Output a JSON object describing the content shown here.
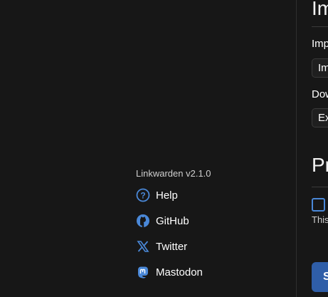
{
  "sidebar": {
    "version": "Linkwarden v2.1.0",
    "links": [
      {
        "label": "Help",
        "icon": "help-circle-icon"
      },
      {
        "label": "GitHub",
        "icon": "github-icon"
      },
      {
        "label": "Twitter",
        "icon": "x-twitter-icon"
      },
      {
        "label": "Mastodon",
        "icon": "mastodon-icon"
      }
    ]
  },
  "main": {
    "import_export_heading": "Import & Export",
    "import_label": "Import your data from other platforms.",
    "import_button": "Import From",
    "download_label": "Download your data",
    "export_button": "Export Data",
    "privacy_heading": "Privacy",
    "privacy_checkbox_desc": "This",
    "save_button": "Save"
  },
  "colors": {
    "accent": "#4a88d8",
    "save": "#2f5ea8",
    "background": "#171717"
  }
}
